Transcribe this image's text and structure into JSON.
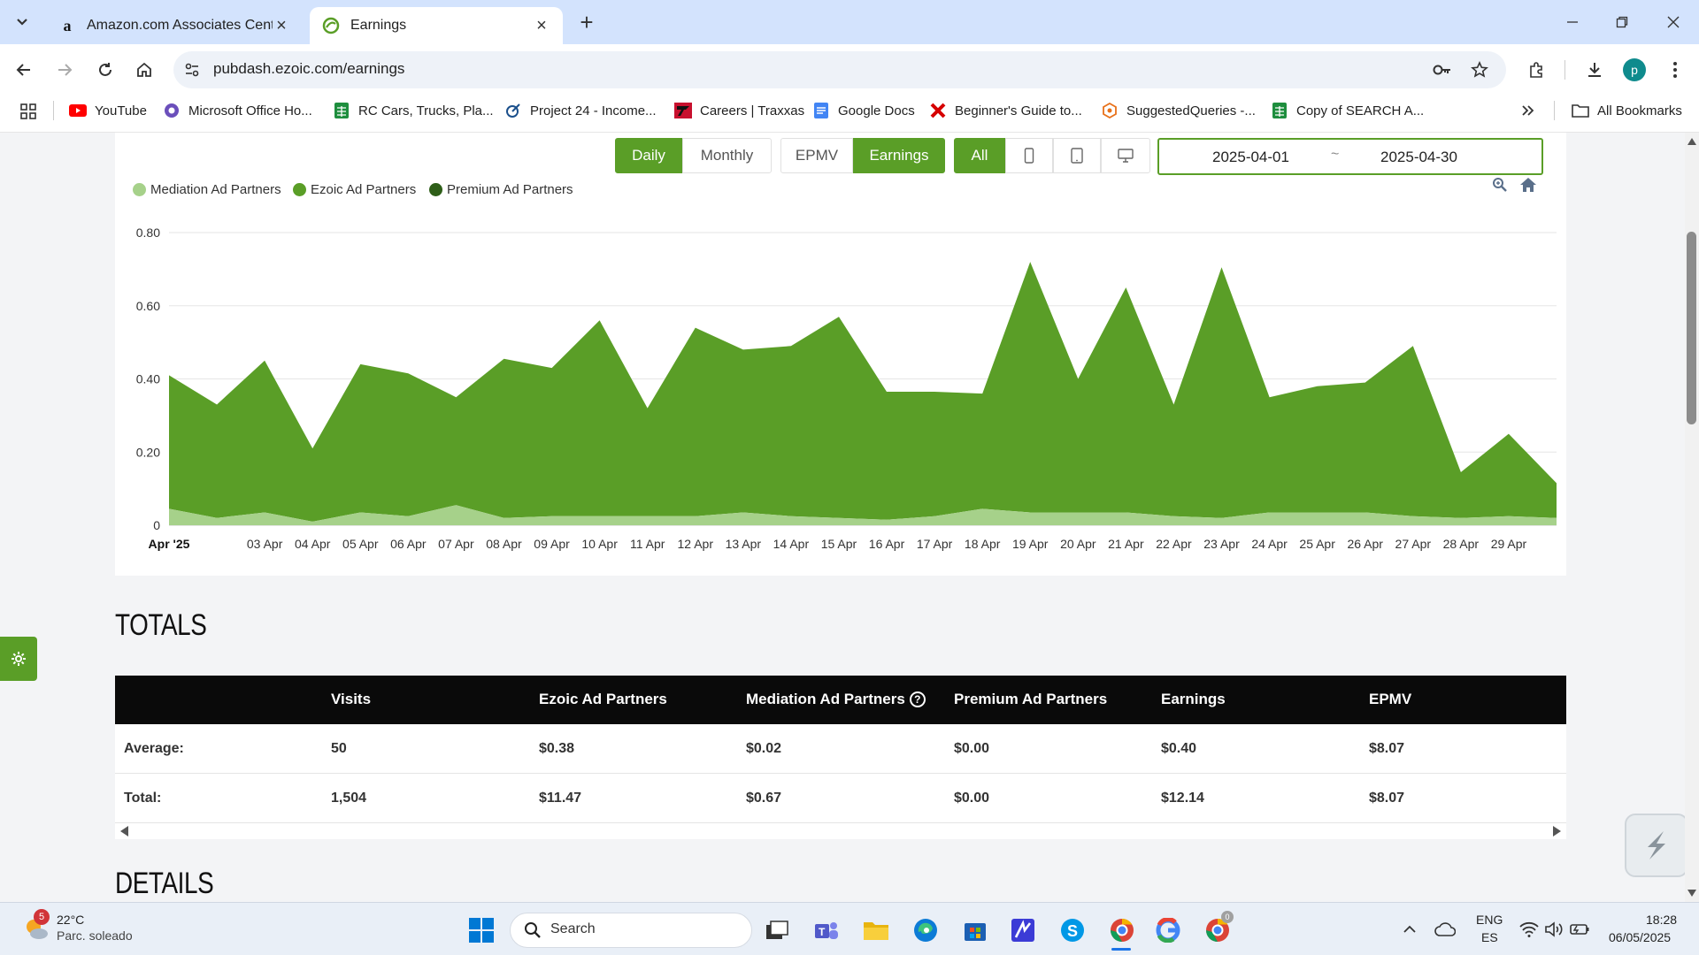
{
  "browser": {
    "tabs": [
      {
        "title": "Amazon.com Associates Central",
        "favicon": "amazon-a-icon",
        "active": false
      },
      {
        "title": "Earnings",
        "favicon": "ezoic-icon",
        "active": true
      }
    ],
    "url": "pubdash.ezoic.com/earnings",
    "bookmarks": [
      {
        "label": "YouTube",
        "icon": "youtube-icon"
      },
      {
        "label": "Microsoft Office Ho...",
        "icon": "office-icon"
      },
      {
        "label": "RC Cars, Trucks, Pla...",
        "icon": "sheets-icon"
      },
      {
        "label": "Project 24 - Income...",
        "icon": "project-icon"
      },
      {
        "label": "Careers | Traxxas",
        "icon": "traxxas-icon"
      },
      {
        "label": "Google Docs",
        "icon": "docs-icon"
      },
      {
        "label": "Beginner's Guide to...",
        "icon": "x-icon"
      },
      {
        "label": "SuggestedQueries -...",
        "icon": "suggest-icon"
      },
      {
        "label": "Copy of SEARCH A...",
        "icon": "sheets-icon"
      }
    ],
    "all_bookmarks": "All Bookmarks",
    "profile_initial": "p"
  },
  "controls": {
    "period": {
      "daily": "Daily",
      "monthly": "Monthly",
      "selected": "Daily"
    },
    "metric": {
      "epmv": "EPMV",
      "earnings": "Earnings",
      "selected": "Earnings"
    },
    "device": {
      "all": "All",
      "selected": "All"
    },
    "date_start": "2025-04-01",
    "date_sep": "~",
    "date_end": "2025-04-30"
  },
  "chart_data": {
    "type": "area",
    "stacked": true,
    "title": "",
    "xlabel": "",
    "ylabel": "",
    "ylim": [
      0,
      0.8
    ],
    "yticks": [
      "0",
      "0.20",
      "0.40",
      "0.60",
      "0.80"
    ],
    "x_tick_labels": [
      "Apr '25",
      "03 Apr",
      "04 Apr",
      "05 Apr",
      "06 Apr",
      "07 Apr",
      "08 Apr",
      "09 Apr",
      "10 Apr",
      "11 Apr",
      "12 Apr",
      "13 Apr",
      "14 Apr",
      "15 Apr",
      "16 Apr",
      "17 Apr",
      "18 Apr",
      "19 Apr",
      "20 Apr",
      "21 Apr",
      "22 Apr",
      "23 Apr",
      "24 Apr",
      "25 Apr",
      "26 Apr",
      "27 Apr",
      "28 Apr",
      "29 Apr"
    ],
    "x": [
      "2025-04-01",
      "2025-04-02",
      "2025-04-03",
      "2025-04-04",
      "2025-04-05",
      "2025-04-06",
      "2025-04-07",
      "2025-04-08",
      "2025-04-09",
      "2025-04-10",
      "2025-04-11",
      "2025-04-12",
      "2025-04-13",
      "2025-04-14",
      "2025-04-15",
      "2025-04-16",
      "2025-04-17",
      "2025-04-18",
      "2025-04-19",
      "2025-04-20",
      "2025-04-21",
      "2025-04-22",
      "2025-04-23",
      "2025-04-24",
      "2025-04-25",
      "2025-04-26",
      "2025-04-27",
      "2025-04-28",
      "2025-04-29",
      "2025-04-30"
    ],
    "legend_position": "top-left",
    "grid": true,
    "series": [
      {
        "name": "Mediation Ad Partners",
        "color": "#a6d18a",
        "values": [
          0.045,
          0.02,
          0.035,
          0.01,
          0.035,
          0.025,
          0.055,
          0.02,
          0.025,
          0.025,
          0.025,
          0.025,
          0.035,
          0.025,
          0.02,
          0.015,
          0.025,
          0.045,
          0.035,
          0.035,
          0.035,
          0.025,
          0.02,
          0.035,
          0.035,
          0.035,
          0.025,
          0.02,
          0.025,
          0.02
        ]
      },
      {
        "name": "Ezoic Ad Partners",
        "color": "#5a9e27",
        "values": [
          0.365,
          0.31,
          0.415,
          0.2,
          0.405,
          0.39,
          0.295,
          0.435,
          0.405,
          0.535,
          0.295,
          0.515,
          0.445,
          0.465,
          0.55,
          0.35,
          0.34,
          0.315,
          0.685,
          0.365,
          0.615,
          0.305,
          0.685,
          0.315,
          0.345,
          0.355,
          0.465,
          0.125,
          0.225,
          0.095
        ]
      },
      {
        "name": "Premium Ad Partners",
        "color": "#2e5e18",
        "values": [
          0,
          0,
          0,
          0,
          0,
          0,
          0,
          0,
          0,
          0,
          0,
          0,
          0,
          0,
          0,
          0,
          0,
          0,
          0,
          0,
          0,
          0,
          0,
          0,
          0,
          0,
          0,
          0,
          0,
          0
        ]
      }
    ]
  },
  "totals": {
    "title": "TOTALS",
    "columns": [
      "Visits",
      "Ezoic Ad Partners",
      "Mediation Ad Partners",
      "Premium Ad Partners",
      "Earnings",
      "EPMV"
    ],
    "rows": [
      {
        "label": "Average:",
        "values": [
          "50",
          "$0.38",
          "$0.02",
          "$0.00",
          "$0.40",
          "$8.07"
        ]
      },
      {
        "label": "Total:",
        "values": [
          "1,504",
          "$11.47",
          "$0.67",
          "$0.00",
          "$12.14",
          "$8.07"
        ]
      }
    ]
  },
  "details": {
    "title": "DETAILS"
  },
  "taskbar": {
    "weather_temp": "22°C",
    "weather_desc": "Parc. soleado",
    "weather_badge": "5",
    "search_placeholder": "Search",
    "lang_top": "ENG",
    "lang_bottom": "ES",
    "time": "18:28",
    "date": "06/05/2025",
    "chrome_badge": "0"
  }
}
